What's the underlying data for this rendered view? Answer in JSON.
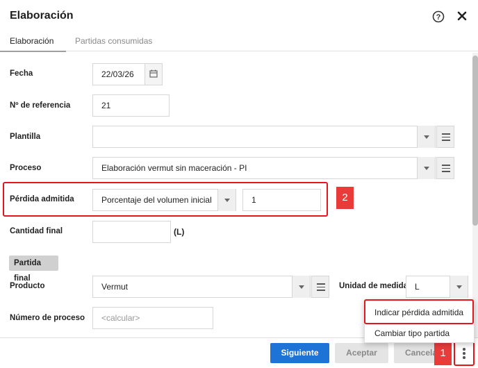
{
  "window": {
    "title": "Elaboración"
  },
  "tabs": [
    {
      "label": "Elaboración",
      "active": true
    },
    {
      "label": "Partidas consumidas",
      "active": false
    }
  ],
  "form": {
    "fecha": {
      "label": "Fecha",
      "value": "22/03/26"
    },
    "referencia": {
      "label": "Nº de referencia",
      "value": "21"
    },
    "plantilla": {
      "label": "Plantilla",
      "value": ""
    },
    "proceso": {
      "label": "Proceso",
      "value": "Elaboración vermut sin maceración - PI"
    },
    "perdida": {
      "label": "Pérdida admitida",
      "type_value": "Porcentaje del volumen inicial",
      "value": "1"
    },
    "cantidad_final": {
      "label": "Cantidad final",
      "value": "",
      "unit": "(L)"
    },
    "section_label": "Partida final",
    "producto": {
      "label": "Producto",
      "value": "Vermut"
    },
    "unidad": {
      "label": "Unidad de medida",
      "value": "L"
    },
    "numero_proceso": {
      "label": "Número de proceso",
      "placeholder": "<calcular>"
    }
  },
  "annotations": {
    "badge_1": "1",
    "badge_2": "2"
  },
  "popup_menu": {
    "items": [
      "Indicar pérdida admitida",
      "Cambiar tipo partida"
    ]
  },
  "footer": {
    "siguiente": "Siguiente",
    "aceptar": "Aceptar",
    "cancelar": "Cancelar"
  },
  "colors": {
    "primary": "#1e73d6",
    "highlight": "#e3161b",
    "badge": "#ea3b3b"
  },
  "icons": [
    "help-icon",
    "close-icon",
    "calendar-icon",
    "menu-icon",
    "chevron-down-icon",
    "more-vertical-icon"
  ]
}
